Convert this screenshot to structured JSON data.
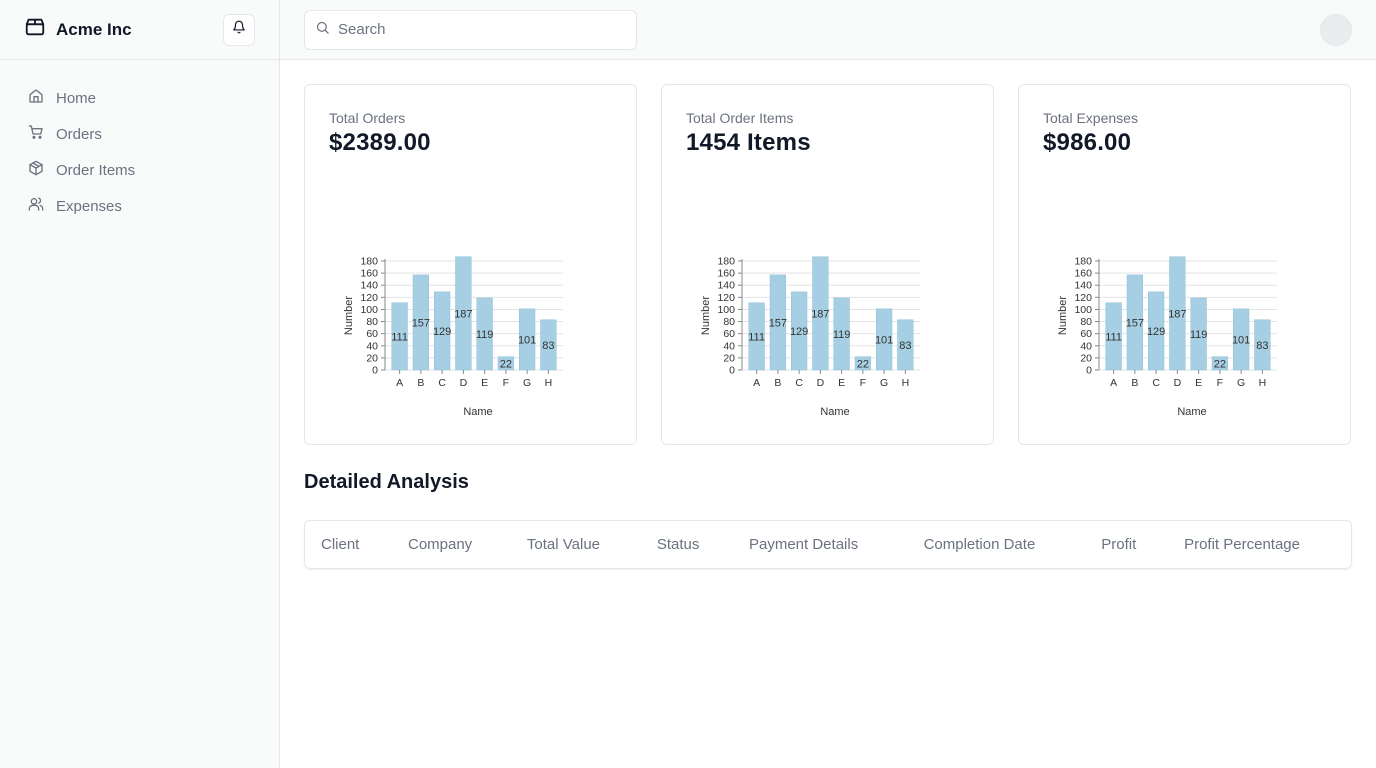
{
  "brand": {
    "name": "Acme Inc",
    "icon": "package-icon"
  },
  "notifications": {
    "icon": "bell-icon"
  },
  "nav": [
    {
      "label": "Home",
      "icon": "home-icon"
    },
    {
      "label": "Orders",
      "icon": "cart-icon"
    },
    {
      "label": "Order Items",
      "icon": "box-icon"
    },
    {
      "label": "Expenses",
      "icon": "users-icon"
    }
  ],
  "search": {
    "placeholder": "Search",
    "icon": "search-icon"
  },
  "cards": [
    {
      "title": "Total Orders",
      "value": "$2389.00"
    },
    {
      "title": "Total Order Items",
      "value": "1454 Items"
    },
    {
      "title": "Total Expenses",
      "value": "$986.00"
    }
  ],
  "chart_data": [
    {
      "type": "bar",
      "categories": [
        "A",
        "B",
        "C",
        "D",
        "E",
        "F",
        "G",
        "H"
      ],
      "values": [
        111,
        157,
        129,
        187,
        119,
        22,
        101,
        83
      ],
      "xlabel": "Name",
      "ylabel": "Number",
      "ylim": [
        0,
        180
      ],
      "yticks": [
        0,
        20,
        40,
        60,
        80,
        100,
        120,
        140,
        160,
        180
      ],
      "grid": true,
      "bar_color": "#a6cfe3"
    },
    {
      "type": "bar",
      "categories": [
        "A",
        "B",
        "C",
        "D",
        "E",
        "F",
        "G",
        "H"
      ],
      "values": [
        111,
        157,
        129,
        187,
        119,
        22,
        101,
        83
      ],
      "xlabel": "Name",
      "ylabel": "Number",
      "ylim": [
        0,
        180
      ],
      "yticks": [
        0,
        20,
        40,
        60,
        80,
        100,
        120,
        140,
        160,
        180
      ],
      "grid": true,
      "bar_color": "#a6cfe3"
    },
    {
      "type": "bar",
      "categories": [
        "A",
        "B",
        "C",
        "D",
        "E",
        "F",
        "G",
        "H"
      ],
      "values": [
        111,
        157,
        129,
        187,
        119,
        22,
        101,
        83
      ],
      "xlabel": "Name",
      "ylabel": "Number",
      "ylim": [
        0,
        180
      ],
      "yticks": [
        0,
        20,
        40,
        60,
        80,
        100,
        120,
        140,
        160,
        180
      ],
      "grid": true,
      "bar_color": "#a6cfe3"
    }
  ],
  "section": {
    "title": "Detailed Analysis"
  },
  "table": {
    "columns": [
      "Client",
      "Company",
      "Total Value",
      "Status",
      "Payment Details",
      "Completion Date",
      "Profit",
      "Profit Percentage"
    ]
  }
}
